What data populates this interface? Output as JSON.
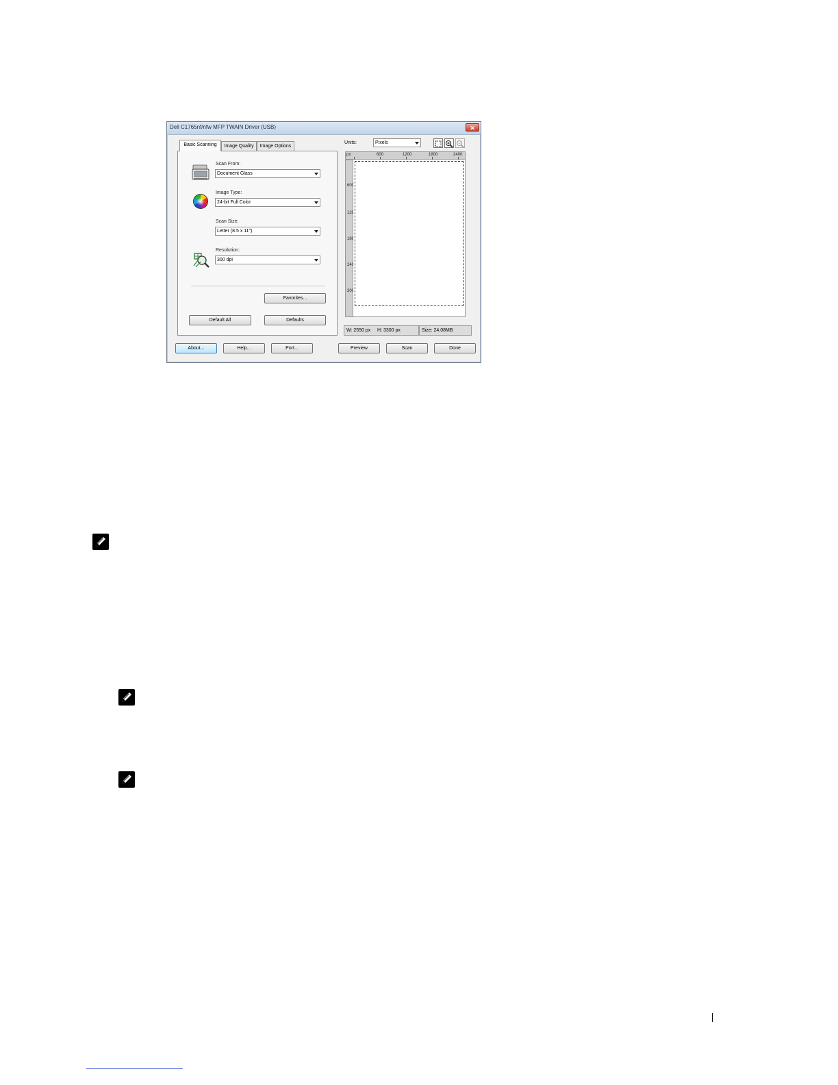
{
  "dialog": {
    "title": "Dell C1765nf/nfw MFP TWAIN Driver (USB)",
    "close_glyph": "✕",
    "tabs": [
      {
        "label": "Basic Scanning",
        "active": true
      },
      {
        "label": "Image Quality",
        "active": false
      },
      {
        "label": "Image Options",
        "active": false
      }
    ],
    "fields": {
      "scan_from": {
        "label": "Scan From:",
        "value": "Document Glass",
        "icon": "scanner-icon"
      },
      "image_type": {
        "label": "Image Type:",
        "value": "24-bit Full Color",
        "icon": "color-wheel-icon"
      },
      "scan_size": {
        "label": "Scan Size:",
        "value": "Letter (8.5 x 11\")"
      },
      "resolution": {
        "label": "Resolution:",
        "value": "300 dpi",
        "icon": "resolution-icon"
      }
    },
    "panel_buttons": {
      "favorites": "Favorites...",
      "default_all": "Default All",
      "defaults": "Defaults"
    },
    "preview": {
      "units_label": "Units:",
      "units_value": "Pixels",
      "ruler_unit": "px",
      "ruler_h_ticks": [
        "600",
        "1200",
        "1800",
        "2400"
      ],
      "ruler_v_ticks": [
        "600",
        "1200",
        "1800",
        "2400",
        "3000"
      ],
      "tools": [
        "select-area-icon",
        "zoom-in-icon",
        "zoom-out-icon"
      ],
      "status_width": "W: 2550 px",
      "status_height": "H: 3300 px",
      "status_size": "Size: 24.08MB"
    },
    "bottom_buttons": {
      "about": "About...",
      "help": "Help...",
      "port": "Port...",
      "preview": "Preview",
      "scan": "Scan",
      "done": "Done"
    }
  },
  "colors": {
    "title_bar": "#c4d5ea",
    "close_button": "#c5402f",
    "footer_link_line": "#3b5bdb"
  }
}
